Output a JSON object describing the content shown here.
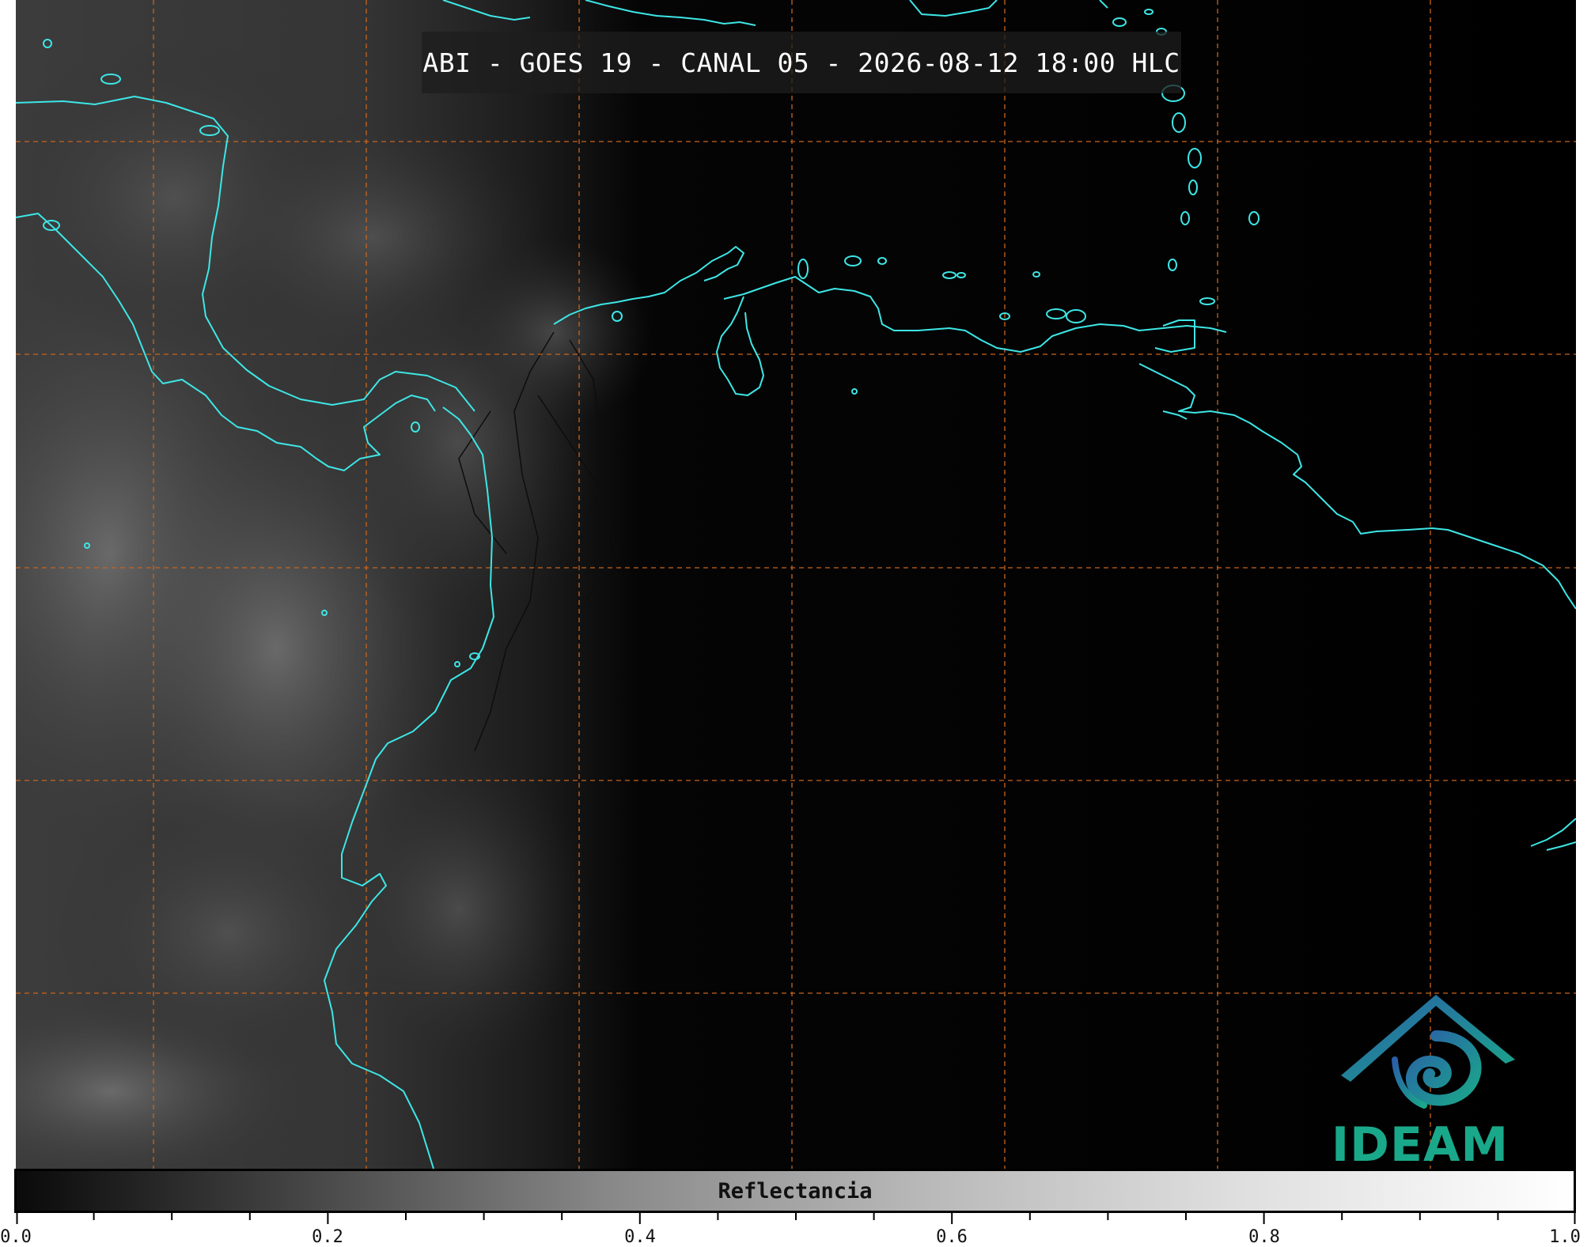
{
  "title": "ABI - GOES 19 - CANAL 05 - 2026-08-12 18:00 HLC",
  "logo": {
    "text": "IDEAM",
    "icon": "ideam-logo-icon"
  },
  "colorbar": {
    "label": "Reflectancia",
    "ticks": [
      "0.0",
      "0.2",
      "0.4",
      "0.6",
      "0.8",
      "1.0"
    ],
    "range": [
      0.0,
      1.0
    ]
  },
  "colors": {
    "coastline": "#3ee6e6",
    "gridline": "#c8641e",
    "logo_text": "#1aa88a"
  }
}
